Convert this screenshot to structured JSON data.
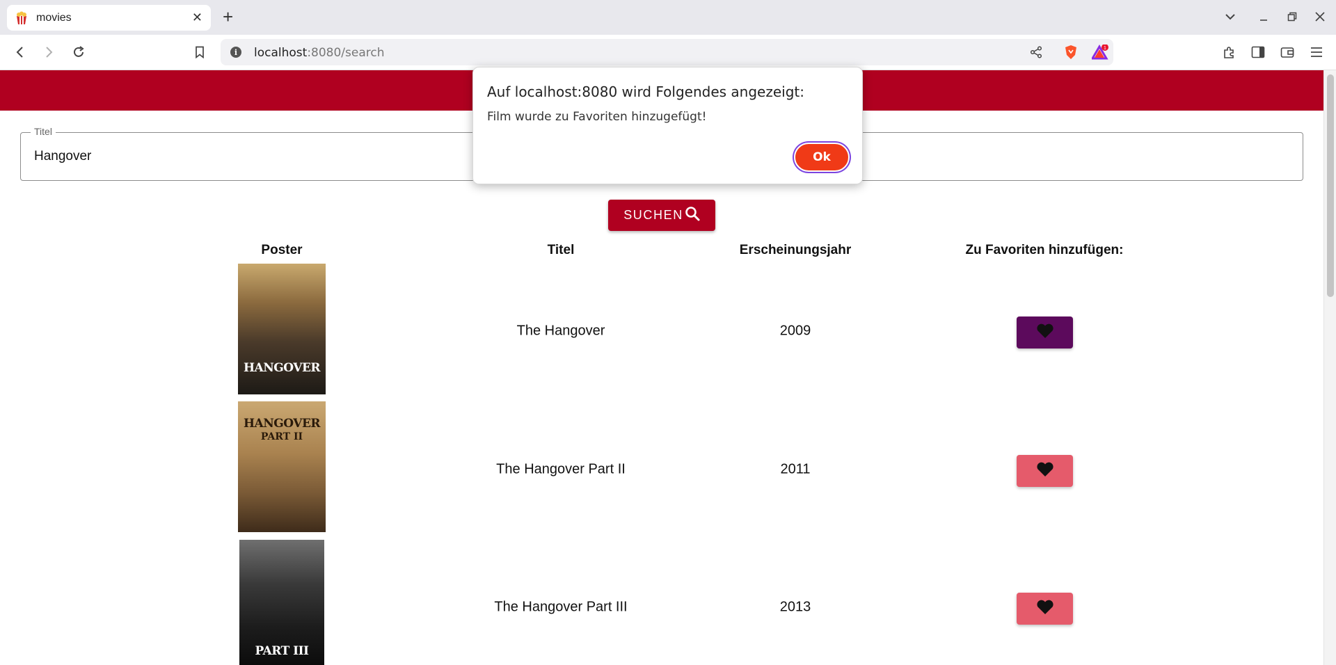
{
  "browser": {
    "tab_title": "movies",
    "url_host": "localhost",
    "url_path": ":8080/search",
    "notification_count": "1"
  },
  "search": {
    "legend": "Titel",
    "value": "Hangover",
    "button_label": "SUCHEN"
  },
  "table": {
    "headers": [
      "Poster",
      "Titel",
      "Erscheinungsjahr",
      "Zu Favoriten hinzufügen:"
    ],
    "rows": [
      {
        "title": "The Hangover",
        "year": "2009",
        "poster_word": "HANGOVER",
        "poster_tagline": "",
        "favorite_active": true
      },
      {
        "title": "The Hangover Part II",
        "year": "2011",
        "poster_word": "HANGOVER",
        "poster_tagline": "PART II",
        "favorite_active": false
      },
      {
        "title": "The Hangover Part III",
        "year": "2013",
        "poster_word": "PART III",
        "poster_tagline": "",
        "favorite_active": false
      }
    ]
  },
  "dialog": {
    "title": "Auf localhost:8080 wird Folgendes angezeigt:",
    "message": "Film wurde zu Favoriten hinzugefügt!",
    "ok_label": "Ok"
  },
  "colors": {
    "header_red": "#b00020",
    "favorite_active": "#5c0a5c",
    "favorite_inactive": "#e55b6b",
    "dialog_ok": "#f03a17"
  }
}
